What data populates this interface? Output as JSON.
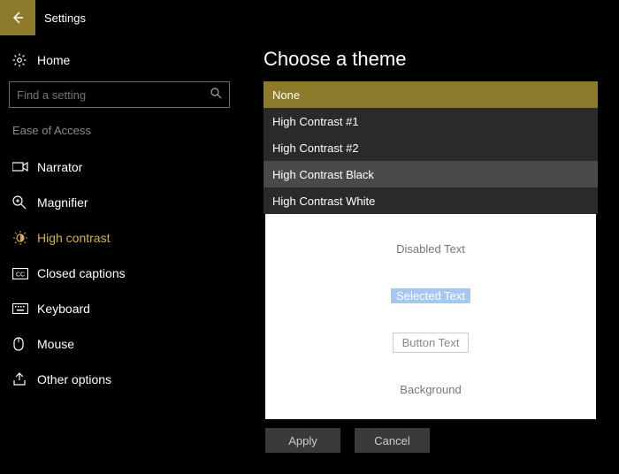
{
  "app_title": "Settings",
  "home_label": "Home",
  "search": {
    "placeholder": "Find a setting"
  },
  "category": "Ease of Access",
  "nav": {
    "items": [
      {
        "label": "Narrator"
      },
      {
        "label": "Magnifier"
      },
      {
        "label": "High contrast"
      },
      {
        "label": "Closed captions"
      },
      {
        "label": "Keyboard"
      },
      {
        "label": "Mouse"
      },
      {
        "label": "Other options"
      }
    ]
  },
  "heading": "Choose a theme",
  "themes": {
    "items": [
      "None",
      "High Contrast #1",
      "High Contrast #2",
      "High Contrast Black",
      "High Contrast White"
    ]
  },
  "preview": {
    "disabled": "Disabled Text",
    "selected": "Selected Text",
    "button": "Button Text",
    "background": "Background"
  },
  "buttons": {
    "apply": "Apply",
    "cancel": "Cancel"
  }
}
